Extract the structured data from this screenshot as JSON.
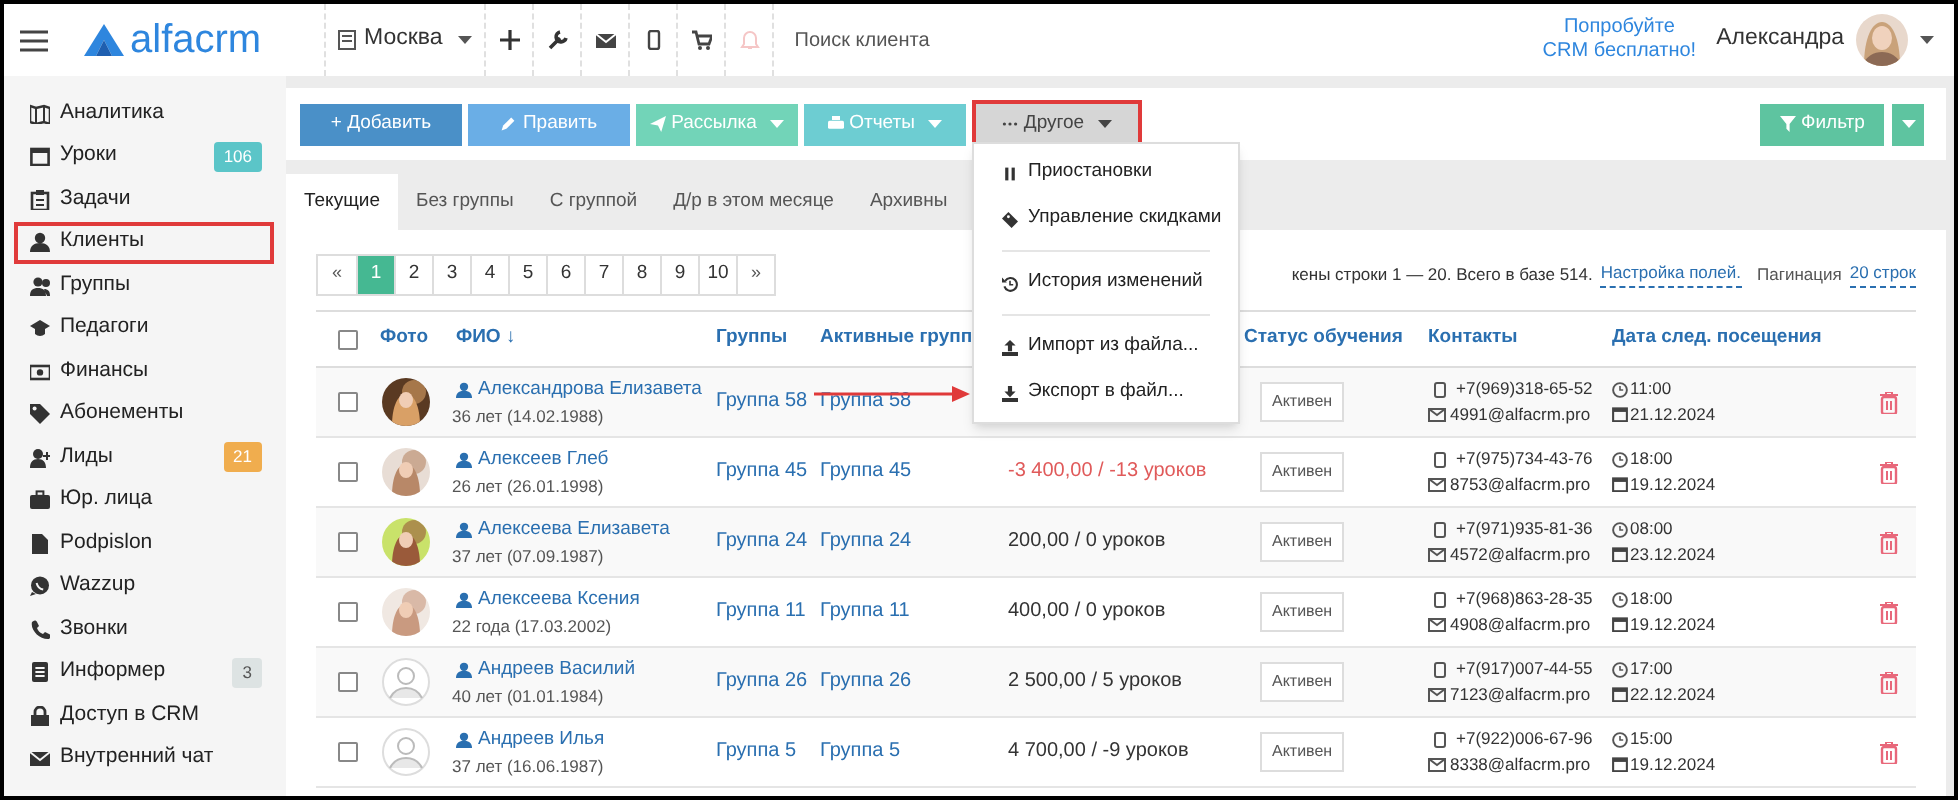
{
  "topbar": {
    "logo": "alfacrm",
    "branch": "Москва",
    "search": {
      "placeholder": "Поиск клиента"
    },
    "promo": [
      "Попробуйте",
      "CRM бесплатно!"
    ],
    "user": "Александра"
  },
  "sidebar": {
    "items": [
      {
        "label": "Аналитика",
        "highlighted": false
      },
      {
        "label": "Уроки",
        "badge": "106",
        "color": "#5bc5c8",
        "highlighted": false
      },
      {
        "label": "Задачи",
        "highlighted": false
      },
      {
        "label": "Клиенты",
        "highlighted": true
      },
      {
        "label": "Группы",
        "highlighted": false
      },
      {
        "label": "Педагоги",
        "highlighted": false
      },
      {
        "label": "Финансы",
        "highlighted": false
      },
      {
        "label": "Абонементы",
        "highlighted": false
      },
      {
        "label": "Лиды",
        "badge": "21",
        "color": "#f0ad4e",
        "highlighted": false
      },
      {
        "label": "Юр. лица",
        "highlighted": false
      },
      {
        "label": "Podpislon",
        "highlighted": false
      },
      {
        "label": "Wazzup",
        "highlighted": false
      },
      {
        "label": "Звонки",
        "highlighted": false
      },
      {
        "label": "Информер",
        "badge": "3",
        "color": "#dde3e3",
        "highlighted": false
      },
      {
        "label": "Доступ в CRM",
        "highlighted": false
      },
      {
        "label": "Внутренний чат",
        "highlighted": false
      }
    ]
  },
  "toolbar": {
    "buttons": [
      {
        "label": "+ Добавить",
        "color": "#4a90c8",
        "dropdown": false,
        "highlighted": false
      },
      {
        "label": "Править",
        "color": "#6aaee6",
        "dropdown": false,
        "highlighted": false
      },
      {
        "label": "Рассылка",
        "color": "#72d4b8",
        "dropdown": true,
        "highlighted": false
      },
      {
        "label": "Отчеты",
        "color": "#6dcdd2",
        "dropdown": true,
        "highlighted": false
      },
      {
        "label": "Другое",
        "color": "#d6d6d6",
        "dropdown": true,
        "highlighted": true
      }
    ],
    "filter": "Фильтр"
  },
  "tabs": [
    {
      "label": "Текущие",
      "selected": true
    },
    {
      "label": "Без группы",
      "selected": false
    },
    {
      "label": "С группой",
      "selected": false
    },
    {
      "label": "Д/р в этом месяце",
      "selected": false
    },
    {
      "label": "Архивны",
      "selected": false
    }
  ],
  "pagination": {
    "prev": "«",
    "next": "»",
    "pages": [
      {
        "label": "1",
        "selected": true
      },
      {
        "label": "2",
        "selected": false
      },
      {
        "label": "3",
        "selected": false
      },
      {
        "label": "4",
        "selected": false
      },
      {
        "label": "5",
        "selected": false
      },
      {
        "label": "6",
        "selected": false
      },
      {
        "label": "7",
        "selected": false
      },
      {
        "label": "8",
        "selected": false
      },
      {
        "label": "9",
        "selected": false
      },
      {
        "label": "10",
        "selected": false
      }
    ]
  },
  "info": {
    "text": "кены строки 1 — 20. Всего в базе 514.",
    "settings_link": "Настройка полей.",
    "pagination_label": "Пагинация",
    "rows_link": "20 строк"
  },
  "menu": {
    "items": [
      {
        "label": "Приостановки",
        "divider_before": false,
        "pointed": false
      },
      {
        "label": "Управление скидками",
        "divider_before": false,
        "pointed": false
      },
      {
        "label": "История изменений",
        "divider_before": true,
        "pointed": false
      },
      {
        "label": "Импорт из файла...",
        "divider_before": true,
        "pointed": false
      },
      {
        "label": "Экспорт в файл...",
        "divider_before": false,
        "pointed": true
      }
    ]
  },
  "table": {
    "columns": [
      "Фото",
      "ФИО ↓",
      "Группы",
      "Активные групп",
      "Статус обучения",
      "Контакты",
      "Дата след. посещения"
    ],
    "select_all_checked": false,
    "rows": [
      {
        "checked": false,
        "name": "Александрова Елизавета",
        "age": "36 лет (14.02.1988)",
        "group": "Группа 58",
        "active_group": "Группа 58",
        "status": "Активен",
        "phone": "+7(969)318-65-52",
        "email": "4991@alfacrm.pro",
        "time": "11:00",
        "date": "21.12.2024"
      },
      {
        "checked": false,
        "name": "Алексеев Глеб",
        "age": "26 лет (26.01.1998)",
        "group": "Группа 45",
        "active_group": "Группа 45",
        "balance": "-3 400,00 / -13 уроков",
        "negative": true,
        "status": "Активен",
        "phone": "+7(975)734-43-76",
        "email": "8753@alfacrm.pro",
        "time": "18:00",
        "date": "19.12.2024"
      },
      {
        "checked": false,
        "name": "Алексеева Елизавета",
        "age": "37 лет (07.09.1987)",
        "group": "Группа 24",
        "active_group": "Группа 24",
        "balance": "200,00 / 0 уроков",
        "negative": false,
        "status": "Активен",
        "phone": "+7(971)935-81-36",
        "email": "4572@alfacrm.pro",
        "time": "08:00",
        "date": "23.12.2024"
      },
      {
        "checked": false,
        "name": "Алексеева Ксения",
        "age": "22 года (17.03.2002)",
        "group": "Группа 11",
        "active_group": "Группа 11",
        "balance": "400,00 / 0 уроков",
        "negative": false,
        "status": "Активен",
        "phone": "+7(968)863-28-35",
        "email": "4908@alfacrm.pro",
        "time": "18:00",
        "date": "19.12.2024"
      },
      {
        "kind": "default",
        "checked": false,
        "name": "Андреев Василий",
        "age": "40 лет (01.01.1984)",
        "group": "Группа 26",
        "active_group": "Группа 26",
        "balance": "2 500,00 / 5 уроков",
        "negative": false,
        "status": "Активен",
        "phone": "+7(917)007-44-55",
        "email": "7123@alfacrm.pro",
        "time": "17:00",
        "date": "22.12.2024"
      },
      {
        "kind": "default",
        "checked": false,
        "name": "Андреев Илья",
        "age": "37 лет (16.06.1987)",
        "group": "Группа 5",
        "active_group": "Группа 5",
        "balance": "4 700,00 / -9 уроков",
        "negative": false,
        "status": "Активен",
        "phone": "+7(922)006-67-96",
        "email": "8338@alfacrm.pro",
        "time": "15:00",
        "date": "19.12.2024"
      }
    ]
  }
}
